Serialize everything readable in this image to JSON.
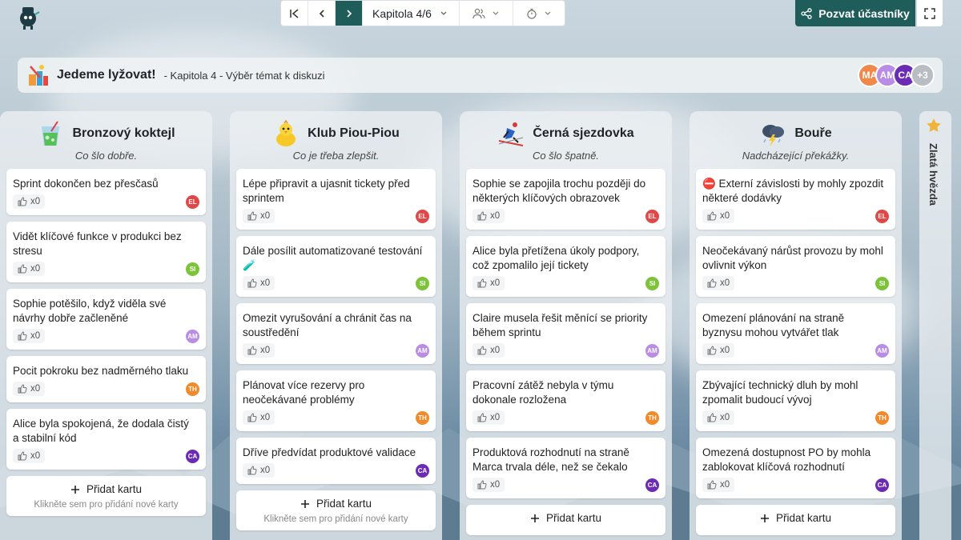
{
  "nav": {
    "chapter": "Kapitola 4/6"
  },
  "invite_label": "Pozvat účastníky",
  "header": {
    "title": "Jedeme lyžovat!",
    "subtitle": "- Kapitola 4 - Výběr témat k diskuzi"
  },
  "avatars": [
    {
      "initials": "MA",
      "color": "#f0884a"
    },
    {
      "initials": "AM",
      "color": "#b98de6"
    },
    {
      "initials": "CA",
      "color": "#6c2bb5"
    },
    {
      "initials": "+3",
      "color": "#b7bdc2"
    }
  ],
  "badge_colors": {
    "EL": "#e04848",
    "SI": "#7cc33a",
    "AM": "#b98de6",
    "TH": "#f08a2a",
    "CA": "#6c2bb5"
  },
  "columns": [
    {
      "title": "Bronzový koktejl",
      "icon": "cocktail-icon",
      "subtitle": "Co šlo dobře.",
      "cards": [
        {
          "text": "Sprint dokončen bez přesčasů",
          "likes": "x0",
          "user": "EL"
        },
        {
          "text": "Vidět klíčové funkce v produkci bez stresu",
          "likes": "x0",
          "user": "SI"
        },
        {
          "text": "Sophie potěšilo, když viděla své návrhy dobře začleněné",
          "likes": "x0",
          "user": "AM"
        },
        {
          "text": "Pocit pokroku bez nadměrného tlaku",
          "likes": "x0",
          "user": "TH"
        },
        {
          "text": "Alice byla spokojená, že dodala čistý a stabilní kód",
          "likes": "x0",
          "user": "CA"
        }
      ],
      "add_label": "Přidat kartu",
      "add_hint": "Klikněte sem pro přidání nové karty"
    },
    {
      "title": "Klub Piou-Piou",
      "icon": "chick-icon",
      "subtitle": "Co je třeba zlepšit.",
      "cards": [
        {
          "text": "Lépe připravit a ujasnit tickety před sprintem",
          "likes": "x0",
          "user": "EL"
        },
        {
          "text": "Dále posílit automatizované testování 🧪",
          "likes": "x0",
          "user": "SI"
        },
        {
          "text": "Omezit vyrušování a chránit čas na soustředění",
          "likes": "x0",
          "user": "AM"
        },
        {
          "text": "Plánovat více rezervy pro neočekávané problémy",
          "likes": "x0",
          "user": "TH"
        },
        {
          "text": "Dříve předvídat produktové validace",
          "likes": "x0",
          "user": "CA"
        }
      ],
      "add_label": "Přidat kartu",
      "add_hint": "Klikněte sem pro přidání nové karty"
    },
    {
      "title": "Černá sjezdovka",
      "icon": "skier-icon",
      "subtitle": "Co šlo špatně.",
      "cards": [
        {
          "text": "Sophie se zapojila trochu později do některých klíčových obrazovek",
          "likes": "x0",
          "user": "EL"
        },
        {
          "text": "Alice byla přetížena úkoly podpory, což zpomalilo její tickety",
          "likes": "x0",
          "user": "SI"
        },
        {
          "text": "Claire musela řešit měnící se priority během sprintu",
          "likes": "x0",
          "user": "AM"
        },
        {
          "text": "Pracovní zátěž nebyla v týmu dokonale rozložena",
          "likes": "x0",
          "user": "TH"
        },
        {
          "text": "Produktová rozhodnutí na straně Marca trvala déle, než se čekalo",
          "likes": "x0",
          "user": "CA"
        }
      ],
      "add_label": "Přidat kartu",
      "add_hint": ""
    },
    {
      "title": "Bouře",
      "icon": "storm-cloud-icon",
      "subtitle": "Nadcházející překážky.",
      "cards": [
        {
          "text": "⛔ Externí závislosti by mohly zpozdit některé dodávky",
          "likes": "x0",
          "user": "EL"
        },
        {
          "text": "Neočekávaný nárůst provozu by mohl ovlivnit výkon",
          "likes": "x0",
          "user": "SI"
        },
        {
          "text": "Omezení plánování na straně byznysu mohou vytvářet tlak",
          "likes": "x0",
          "user": "AM"
        },
        {
          "text": "Zbývající technický dluh by mohl zpomalit budoucí vývoj",
          "likes": "x0",
          "user": "TH"
        },
        {
          "text": "Omezená dostupnost PO by mohla zablokovat klíčová rozhodnutí",
          "likes": "x0",
          "user": "CA"
        }
      ],
      "add_label": "Přidat kartu",
      "add_hint": ""
    }
  ],
  "star_column": {
    "title": "Zlatá hvězda",
    "icon": "star-icon"
  }
}
